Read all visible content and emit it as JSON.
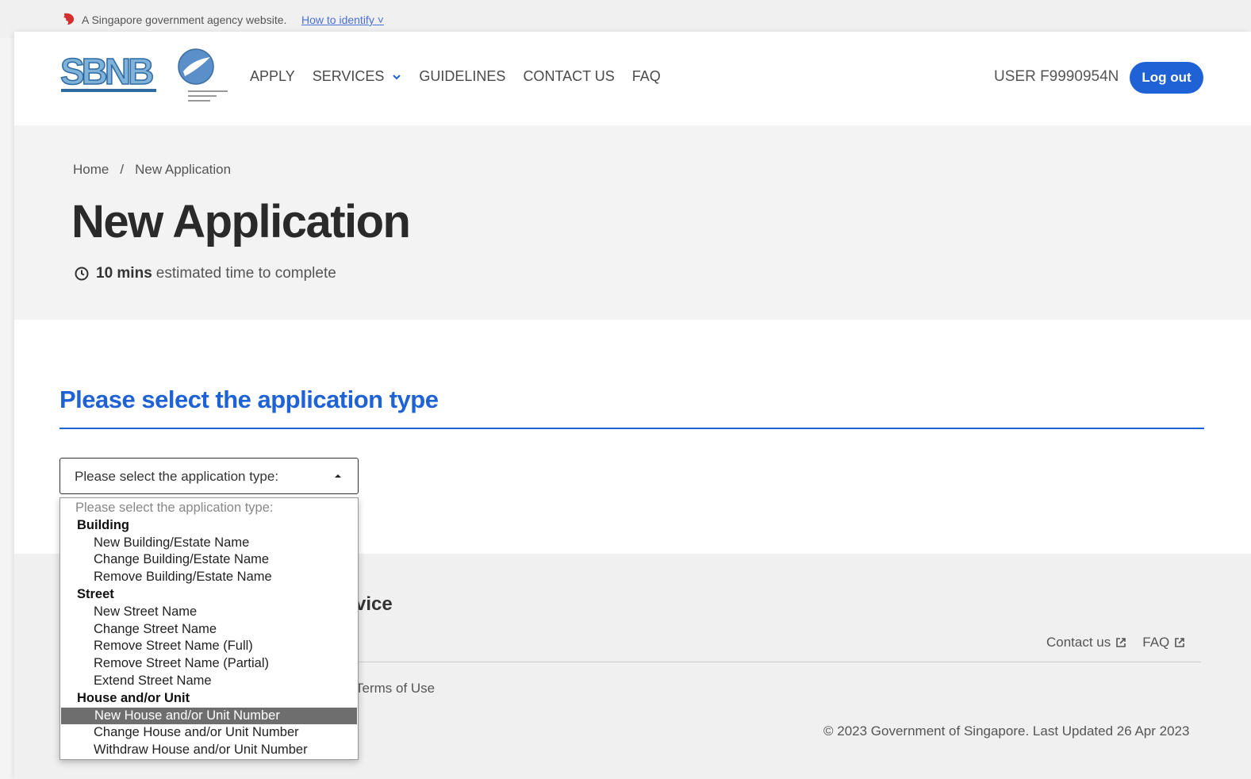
{
  "masthead": {
    "text": "A Singapore government agency website.",
    "link": "How to identify ˅"
  },
  "header": {
    "nav": [
      "APPLY",
      "SERVICES",
      "GUIDELINES",
      "CONTACT US",
      "FAQ"
    ],
    "user": "USER F9990954N",
    "logout": "Log out"
  },
  "breadcrumb": {
    "home": "Home",
    "separator": "/",
    "current": "New Application"
  },
  "page": {
    "title": "New Application",
    "est_time_bold": "10 mins",
    "est_time_text": "estimated time to complete"
  },
  "form": {
    "heading": "Please select the application type",
    "select_value": "Please select the application type:"
  },
  "dropdown": {
    "placeholder": "Please select the application type:",
    "groups": [
      {
        "label": "Building",
        "options": [
          "New Building/Estate Name",
          "Change Building/Estate Name",
          "Remove Building/Estate Name"
        ]
      },
      {
        "label": "Street",
        "options": [
          "New Street Name",
          "Change Street Name",
          "Remove Street Name (Full)",
          "Remove Street Name (Partial)",
          "Extend Street Name"
        ]
      },
      {
        "label": "House and/or Unit",
        "options": [
          "New House and/or Unit Number",
          "Change House and/or Unit Number",
          "Withdraw House and/or Unit Number"
        ]
      }
    ],
    "highlighted": "New House and/or Unit Number"
  },
  "footer": {
    "title_fragment": "vice",
    "contact": "Contact us",
    "faq": "FAQ",
    "terms_fragment": "Terms of Use",
    "copyright": "© 2023 Government of Singapore. Last Updated 26 Apr 2023"
  },
  "colors": {
    "primary": "#1f62d6",
    "highlight": "#6e6e6e",
    "lion": "#d32f2f"
  }
}
